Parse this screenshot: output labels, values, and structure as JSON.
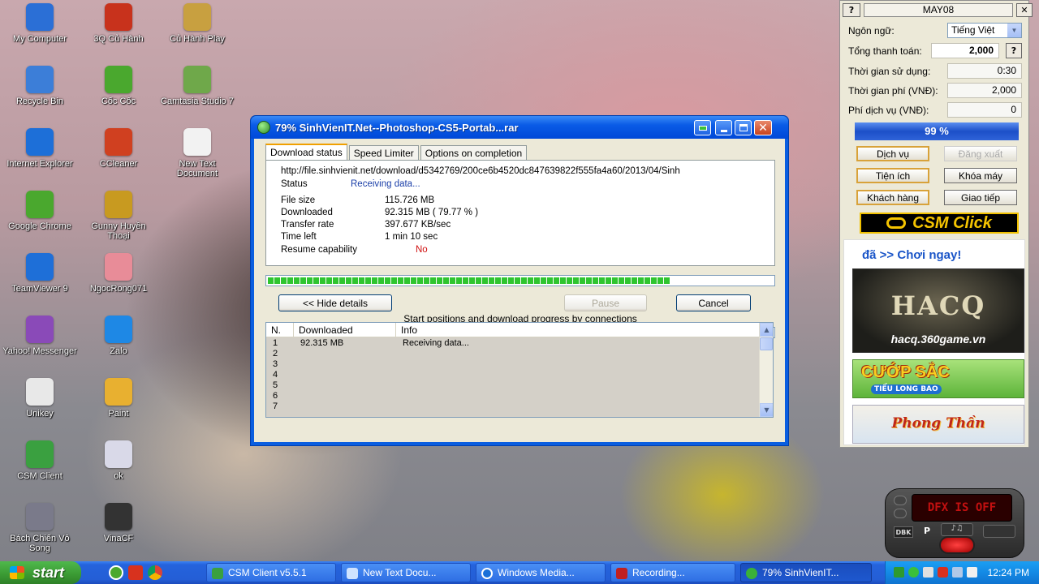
{
  "desktop_icons": [
    {
      "label": "My Computer",
      "icon": "computer-icon",
      "color": "#2b6fd6"
    },
    {
      "label": "3Q Củ Hành",
      "icon": "game-3q-icon",
      "color": "#c8321c"
    },
    {
      "label": "Củ Hành Play",
      "icon": "onion-icon",
      "color": "#c8a040"
    },
    {
      "label": "Recycle Bin",
      "icon": "recycle-bin-icon",
      "color": "#3c7ed8"
    },
    {
      "label": "Cốc Cốc",
      "icon": "coccoc-icon",
      "color": "#4aa82e"
    },
    {
      "label": "Camtasia Studio 7",
      "icon": "camtasia-icon",
      "color": "#6fa84a"
    },
    {
      "label": "Internet Explorer",
      "icon": "ie-icon",
      "color": "#1d6fd8"
    },
    {
      "label": "CCleaner",
      "icon": "ccleaner-icon",
      "color": "#d04020"
    },
    {
      "label": "New Text Document",
      "icon": "text-document-icon",
      "color": "#f2f2f2"
    },
    {
      "label": "Google Chrome",
      "icon": "coccoc-icon",
      "color": "#4aa82e"
    },
    {
      "label": "Gunny Huyền Thoại",
      "icon": "gunny-icon",
      "color": "#c89a20"
    },
    {
      "label": "TeamViewer 9",
      "icon": "teamviewer-icon",
      "color": "#1e6fd8"
    },
    {
      "label": "NgocRong071",
      "icon": "ngocrong-icon",
      "color": "#e88c98"
    },
    {
      "label": "Yahoo! Messenger",
      "icon": "yahoo-icon",
      "color": "#8a4ab8"
    },
    {
      "label": "Zalo",
      "icon": "zalo-icon",
      "color": "#1e88e5"
    },
    {
      "label": "Unikey",
      "icon": "unikey-icon",
      "color": "#e8e8e8"
    },
    {
      "label": "Paint",
      "icon": "paint-icon",
      "color": "#e8b030"
    },
    {
      "label": "CSM Client",
      "icon": "csm-client-icon",
      "color": "#3aa040"
    },
    {
      "label": "ok",
      "icon": "ok-icon",
      "color": "#d9d9e8"
    },
    {
      "label": "Bách Chiến Vô Song",
      "icon": "bcvs-icon",
      "color": "#7a7a8a"
    },
    {
      "label": "VinaCF",
      "icon": "vinacf-icon",
      "color": "#333333"
    }
  ],
  "idm": {
    "title": "79% SinhVienIT.Net--Photoshop-CS5-Portab...rar",
    "tabs": [
      "Download status",
      "Speed Limiter",
      "Options on completion"
    ],
    "url": "http://file.sinhvienit.net/download/d5342769/200ce6b4520dc847639822f555fa4a60/2013/04/Sinh",
    "status_label": "Status",
    "status_value": "Receiving data...",
    "file_size_label": "File size",
    "file_size_value": "115.726  MB",
    "downloaded_label": "Downloaded",
    "downloaded_value": "92.315  MB  ( 79.77 % )",
    "rate_label": "Transfer rate",
    "rate_value": "397.677  KB/sec",
    "time_label": "Time left",
    "time_value": "1 min 10 sec",
    "resume_label": "Resume capability",
    "resume_value": "No",
    "progress_percent": 79.77,
    "hide_details": "<< Hide details",
    "pause": "Pause",
    "cancel": "Cancel",
    "connections_caption": "Start positions and download progress by connections",
    "connections_progress": 80,
    "columns": [
      "N.",
      "Downloaded",
      "Info"
    ],
    "rows": [
      {
        "n": "1",
        "downloaded": "92.315  MB",
        "info": "Receiving data..."
      },
      {
        "n": "2",
        "downloaded": "",
        "info": ""
      },
      {
        "n": "3",
        "downloaded": "",
        "info": ""
      },
      {
        "n": "4",
        "downloaded": "",
        "info": ""
      },
      {
        "n": "5",
        "downloaded": "",
        "info": ""
      },
      {
        "n": "6",
        "downloaded": "",
        "info": ""
      },
      {
        "n": "7",
        "downloaded": "",
        "info": ""
      }
    ]
  },
  "csm": {
    "help": "?",
    "title": "MAY08",
    "close": "✕",
    "language_label": "Ngôn ngữ:",
    "language_value": "Tiếng Việt",
    "total_label": "Tổng thanh toán:",
    "total_value": "2,000",
    "total_help": "?",
    "used_label": "Thời gian sử dụng:",
    "used_value": "0:30",
    "timefee_label": "Thời gian phí (VNĐ):",
    "timefee_value": "2,000",
    "service_label": "Phí dịch vụ (VNĐ):",
    "service_value": "0",
    "percent": "99 %",
    "buttons": [
      "Dịch vụ",
      "Đăng xuất",
      "Tiện ích",
      "Khóa máy",
      "Khách hàng",
      "Giao tiếp"
    ],
    "logo": "CSM Click",
    "promo": "đã >> Chơi ngay!",
    "ad1_title": "HACQ",
    "ad1_site": "hacq.360game.vn",
    "ad2": "CƯỚP SẮC",
    "ad2_sub": "TIỂU LONG BAO",
    "ad3": "Phong Thần"
  },
  "media": {
    "display": "DFX IS OFF",
    "btn_dbk": "DBK",
    "btn_p": "P"
  },
  "taskbar": {
    "start": "start",
    "buttons": [
      "CSM Client v5.5.1",
      "New Text Docu...",
      "Windows Media...",
      "Recording...",
      "79% SinhVienIT..."
    ],
    "clock": "12:24 PM"
  }
}
